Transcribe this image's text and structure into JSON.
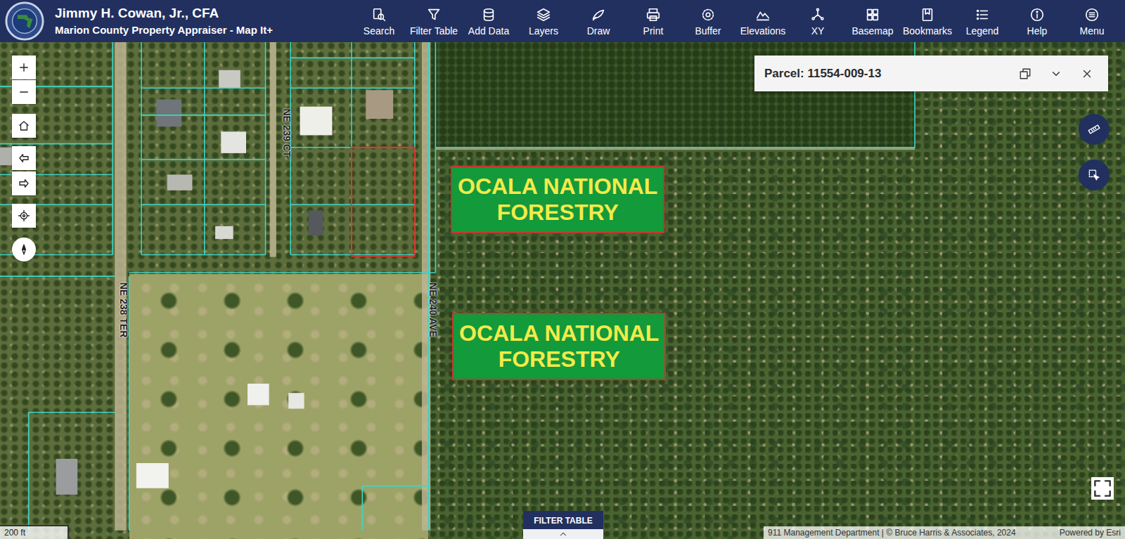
{
  "header": {
    "title": "Jimmy H. Cowan, Jr., CFA",
    "subtitle": "Marion County Property Appraiser - Map It+"
  },
  "toolbar": [
    {
      "label": "Search"
    },
    {
      "label": "Filter Table"
    },
    {
      "label": "Add Data"
    },
    {
      "label": "Layers"
    },
    {
      "label": "Draw"
    },
    {
      "label": "Print"
    },
    {
      "label": "Buffer"
    },
    {
      "label": "Elevations"
    },
    {
      "label": "XY"
    },
    {
      "label": "Basemap"
    },
    {
      "label": "Bookmarks"
    },
    {
      "label": "Legend"
    },
    {
      "label": "Help"
    },
    {
      "label": "Menu"
    }
  ],
  "map": {
    "road_labels": [
      {
        "text": "NE 239 CT"
      },
      {
        "text": "NE 238 TER"
      },
      {
        "text": "NE 240 AVE"
      }
    ],
    "forest_labels": [
      {
        "lines": [
          "OCALA NATIONAL",
          "FORESTRY"
        ]
      },
      {
        "lines": [
          "OCALA NATIONAL",
          "FORESTRY"
        ]
      }
    ],
    "scale": "200 ft",
    "attribution": "911 Management Department | © Bruce Harris & Associates, 2024",
    "powered_by": "Powered by Esri"
  },
  "popup": {
    "title": "Parcel: 11554-009-13"
  },
  "filter_table": {
    "label": "FILTER TABLE"
  }
}
